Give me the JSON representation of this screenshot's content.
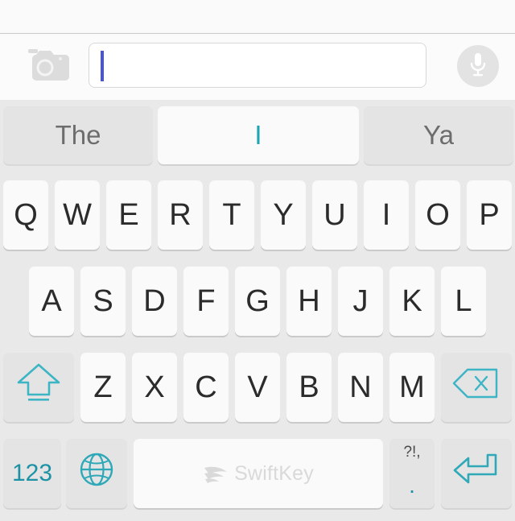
{
  "app": {
    "name": "SwiftKey Keyboard",
    "colors": {
      "teal": "#1b93a5",
      "suggestion_highlight": "#1ba6b5",
      "caret_blue": "#4a54d6",
      "keyboard_background": "#e9e9e9",
      "key_face": "#fafafa",
      "function_key_face": "#e4e4e4",
      "key_label": "#2b2b2b",
      "suggestion_label": "#6d6d6d"
    }
  },
  "input_bar": {
    "camera_icon": "camera-icon",
    "mic_icon": "microphone-icon",
    "text_field": {
      "value": "",
      "placeholder": "",
      "caret_visible": true
    }
  },
  "suggestions": [
    {
      "label": "The",
      "selected": false
    },
    {
      "label": "I",
      "selected": true
    },
    {
      "label": "Ya",
      "selected": false
    }
  ],
  "keyboard": {
    "layout": "qwerty",
    "shift_state": "shifted",
    "rows": [
      {
        "name": "row-1",
        "keys": [
          {
            "label": "Q",
            "type": "letter"
          },
          {
            "label": "W",
            "type": "letter"
          },
          {
            "label": "E",
            "type": "letter"
          },
          {
            "label": "R",
            "type": "letter"
          },
          {
            "label": "T",
            "type": "letter"
          },
          {
            "label": "Y",
            "type": "letter"
          },
          {
            "label": "U",
            "type": "letter"
          },
          {
            "label": "I",
            "type": "letter"
          },
          {
            "label": "O",
            "type": "letter"
          },
          {
            "label": "P",
            "type": "letter"
          }
        ]
      },
      {
        "name": "row-2",
        "keys": [
          {
            "label": "A",
            "type": "letter"
          },
          {
            "label": "S",
            "type": "letter"
          },
          {
            "label": "D",
            "type": "letter"
          },
          {
            "label": "F",
            "type": "letter"
          },
          {
            "label": "G",
            "type": "letter"
          },
          {
            "label": "H",
            "type": "letter"
          },
          {
            "label": "J",
            "type": "letter"
          },
          {
            "label": "K",
            "type": "letter"
          },
          {
            "label": "L",
            "type": "letter"
          }
        ]
      },
      {
        "name": "row-3",
        "keys": [
          {
            "label": "",
            "type": "shift",
            "icon": "shift-arrow-icon"
          },
          {
            "label": "Z",
            "type": "letter"
          },
          {
            "label": "X",
            "type": "letter"
          },
          {
            "label": "C",
            "type": "letter"
          },
          {
            "label": "V",
            "type": "letter"
          },
          {
            "label": "B",
            "type": "letter"
          },
          {
            "label": "N",
            "type": "letter"
          },
          {
            "label": "M",
            "type": "letter"
          },
          {
            "label": "",
            "type": "backspace",
            "icon": "backspace-icon"
          }
        ]
      },
      {
        "name": "row-4",
        "keys": [
          {
            "label": "123",
            "type": "numeric-mode"
          },
          {
            "label": "",
            "type": "language",
            "icon": "globe-icon"
          },
          {
            "label": "SwiftKey",
            "type": "space",
            "icon": "swiftkey-logo-icon"
          },
          {
            "label": "?!,",
            "secondary_label": ".",
            "type": "punctuation"
          },
          {
            "label": "",
            "type": "enter",
            "icon": "return-arrow-icon"
          }
        ]
      }
    ]
  }
}
